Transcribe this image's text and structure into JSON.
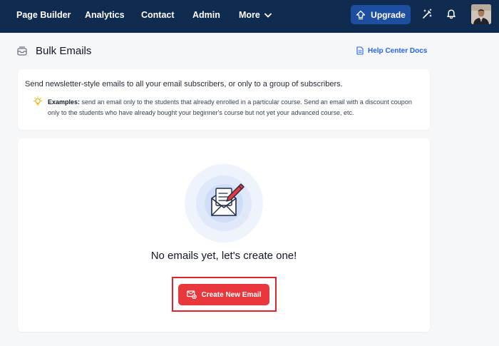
{
  "nav": {
    "items": [
      "Page Builder",
      "Analytics",
      "Contact",
      "Admin"
    ],
    "more_label": "More",
    "upgrade_label": "Upgrade"
  },
  "page": {
    "title": "Bulk Emails",
    "help_link": "Help Center Docs"
  },
  "info": {
    "main_text": "Send newsletter-style emails to all your email subscribers, or only to a group of subscribers.",
    "examples_label": "Examples:",
    "examples_text": "send an email only to the students that already enrolled in a particular course. Send an email with a discount coupon only to the students who have already bought your beginner's course but not yet your advanced course, etc."
  },
  "empty_state": {
    "message": "No emails yet, let's create one!",
    "button_label": "Create New Email"
  },
  "colors": {
    "nav_bg": "#0f2b4f",
    "upgrade_bg": "#1d4ea0",
    "accent_link": "#2563eb",
    "create_button_bg": "#e8383d",
    "highlight_border": "#e0232e"
  },
  "icons": [
    "upgrade-arrow-icon",
    "magic-wand-icon",
    "bell-icon",
    "chevron-down-icon",
    "mail-box-icon",
    "document-icon",
    "lightbulb-icon",
    "envelope-letter-icon",
    "mail-add-icon"
  ]
}
